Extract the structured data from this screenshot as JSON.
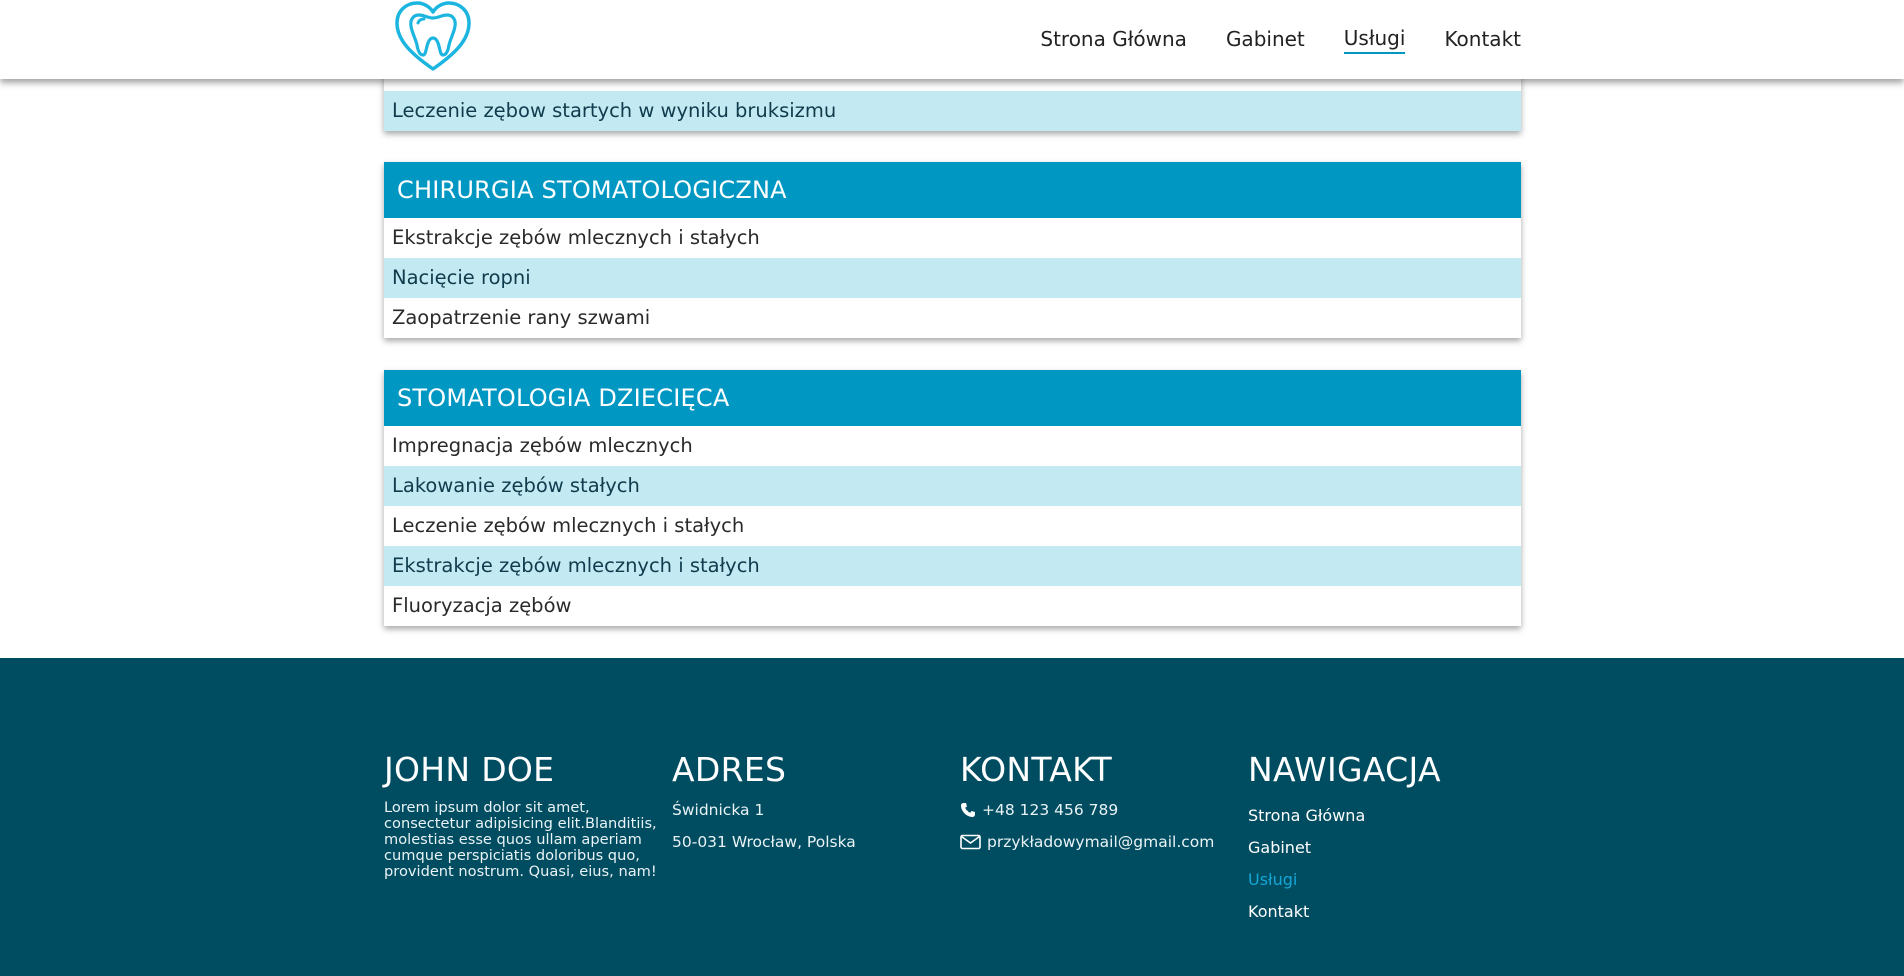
{
  "header": {
    "logo_icon": "tooth-heart-logo",
    "nav": [
      {
        "label": "Strona Główna",
        "active": false
      },
      {
        "label": "Gabinet",
        "active": false
      },
      {
        "label": "Usługi",
        "active": true
      },
      {
        "label": "Kontakt",
        "active": false
      }
    ]
  },
  "sections": [
    {
      "title": "",
      "rows": [
        "Leczenie zębow startych w wyniku bruksizmu"
      ]
    },
    {
      "title": "CHIRURGIA STOMATOLOGICZNA",
      "rows": [
        "Ekstrakcje zębów mlecznych i stałych",
        "Nacięcie ropni",
        "Zaopatrzenie rany szwami"
      ]
    },
    {
      "title": "STOMATOLOGIA DZIECIĘCA",
      "rows": [
        "Impregnacja zębów mlecznych",
        "Lakowanie zębów stałych",
        "Leczenie zębów mlecznych i stałych",
        "Ekstrakcje zębów mlecznych i stałych",
        "Fluoryzacja zębów"
      ]
    }
  ],
  "footer": {
    "about": {
      "title": "JOHN DOE",
      "text": "Lorem ipsum dolor sit amet, consectetur adipisicing elit.Blanditiis, molestias esse quos ullam aperiam cumque perspiciatis doloribus quo, provident nostrum. Quasi, eius, nam!"
    },
    "address": {
      "title": "ADRES",
      "street": "Świdnicka 1",
      "city": "50-031 Wrocław, Polska"
    },
    "contact": {
      "title": "KONTAKT",
      "phone": "+48 123 456 789",
      "email": "przykładowymail@gmail.com"
    },
    "navigation": {
      "title": "NAWIGACJA",
      "links": [
        "Strona Główna",
        "Gabinet",
        "Usługi",
        "Kontakt"
      ],
      "active_index": 2
    }
  },
  "colors": {
    "accent": "#0197c3",
    "row_alt": "#c3e9f2",
    "footer_bg": "#004c60",
    "logo": "#1bb5e0",
    "active_link": "#13a7d6"
  }
}
